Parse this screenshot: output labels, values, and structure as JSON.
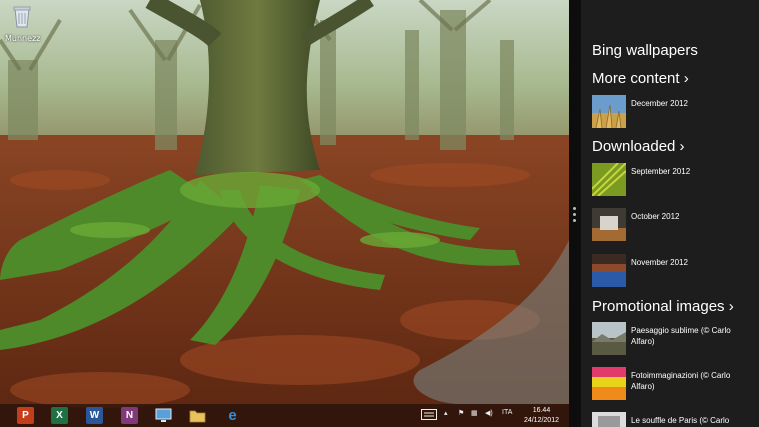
{
  "desktop": {
    "recycle_bin": {
      "label": "Munnezz",
      "icon": "recycle-bin-icon"
    }
  },
  "taskbar": {
    "apps": [
      {
        "name": "powerpoint",
        "glyph": "P",
        "color": "#c43e1c"
      },
      {
        "name": "excel",
        "glyph": "X",
        "color": "#1e7145"
      },
      {
        "name": "word",
        "glyph": "W",
        "color": "#2b579a"
      },
      {
        "name": "onenote",
        "glyph": "N",
        "color": "#80397b"
      },
      {
        "name": "remote-desktop",
        "glyph": "",
        "color": "#5aa0d8"
      },
      {
        "name": "file-explorer",
        "glyph": "",
        "color": "#e8c25a"
      },
      {
        "name": "internet-explorer",
        "glyph": "e",
        "color": "#2f8fe0"
      }
    ],
    "language": "ITA",
    "time": "16.44",
    "date": "24/12/2012"
  },
  "sidebar": {
    "title": "Bing wallpapers",
    "more_content": {
      "heading": "More content ›",
      "items": [
        {
          "label": "December 2012"
        }
      ]
    },
    "downloaded": {
      "heading": "Downloaded ›",
      "items": [
        {
          "label": "September 2012"
        },
        {
          "label": "October 2012"
        },
        {
          "label": "November 2012"
        }
      ]
    },
    "promotional": {
      "heading": "Promotional images ›",
      "items": [
        {
          "label": "Paesaggio sublime (© Carlo Alfaro)"
        },
        {
          "label": "Fotoimmaginazioni (© Carlo Alfaro)"
        },
        {
          "label": "Le souffle de Paris (© Carlo"
        }
      ]
    }
  }
}
